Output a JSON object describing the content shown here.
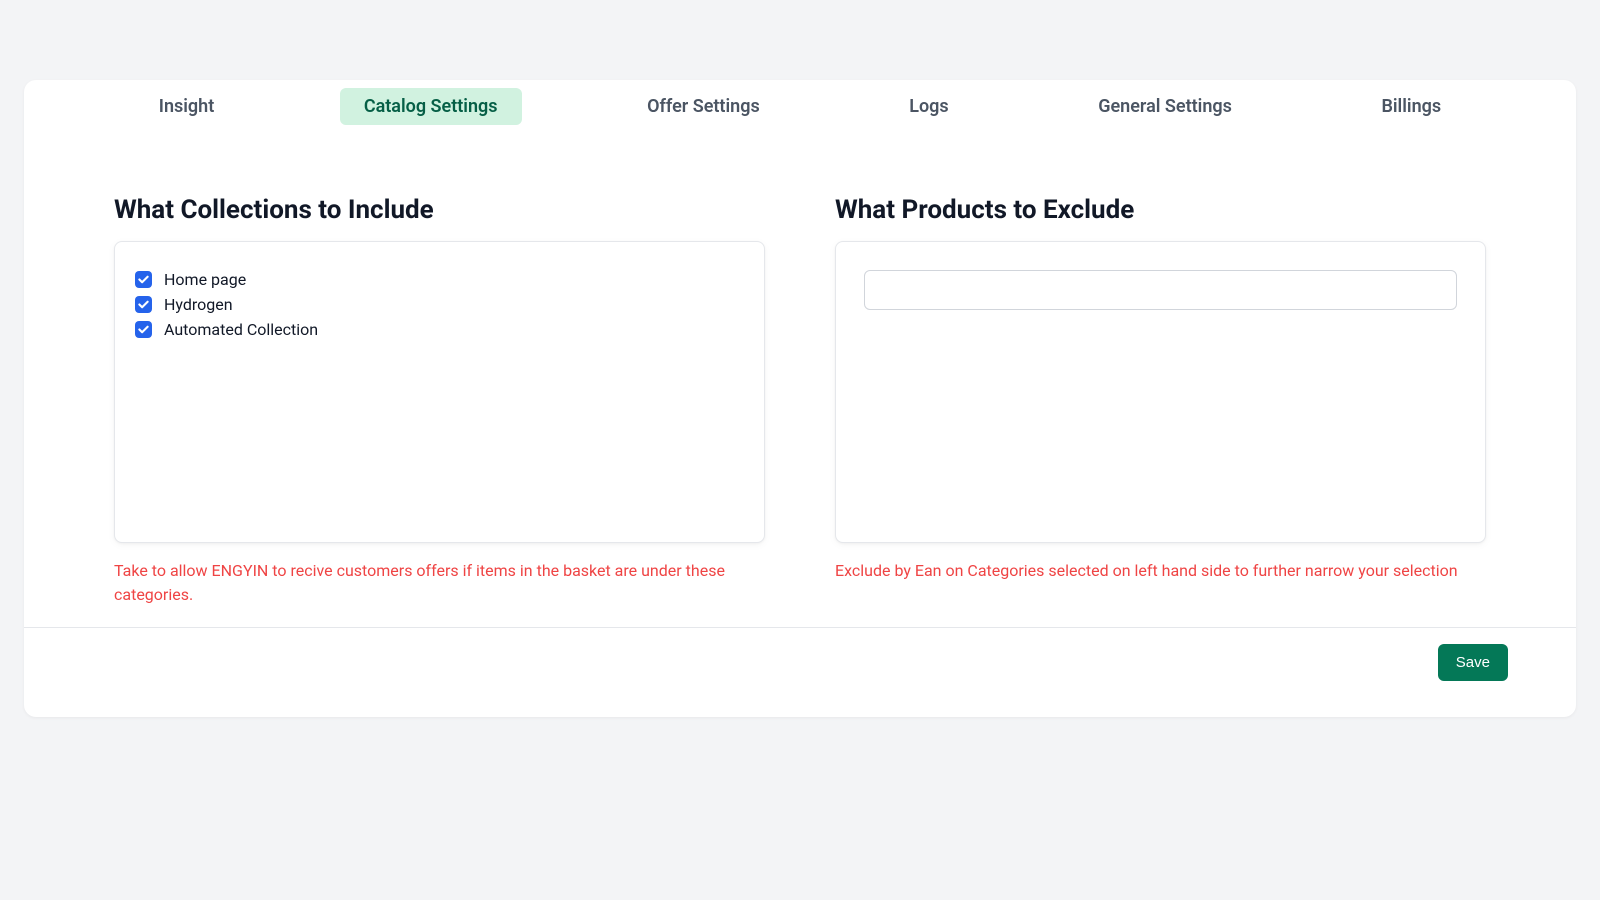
{
  "tabs": [
    {
      "label": "Insight",
      "active": false
    },
    {
      "label": "Catalog Settings",
      "active": true
    },
    {
      "label": "Offer Settings",
      "active": false
    },
    {
      "label": "Logs",
      "active": false
    },
    {
      "label": "General Settings",
      "active": false
    },
    {
      "label": "Billings",
      "active": false
    }
  ],
  "left": {
    "title": "What Collections to Include",
    "items": [
      {
        "label": "Home page",
        "checked": true
      },
      {
        "label": "Hydrogen",
        "checked": true
      },
      {
        "label": "Automated Collection",
        "checked": true
      }
    ],
    "help": "Take to allow ENGYIN to recive customers offers if items in the basket are under these categories."
  },
  "right": {
    "title": "What Products to Exclude",
    "input_value": "",
    "help": "Exclude by Ean on Categories selected on left hand side to further narrow your selection"
  },
  "footer": {
    "save_label": "Save"
  }
}
